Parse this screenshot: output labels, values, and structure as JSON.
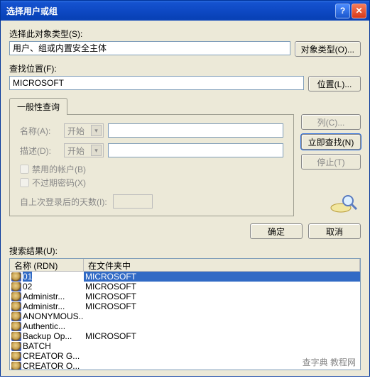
{
  "title": "选择用户或组",
  "labels": {
    "object_type": "选择此对象类型(S):",
    "object_value": "用户、组或内置安全主体",
    "btn_object_types": "对象类型(O)...",
    "location": "查找位置(F):",
    "location_value": "MICROSOFT",
    "btn_locations": "位置(L)...",
    "tab_general": "一般性查询",
    "name": "名称(A):",
    "desc": "描述(D):",
    "starts_with": "开始",
    "chk_disabled": "禁用的帐户(B)",
    "chk_noexpire": "不过期密码(X)",
    "days_since": "自上次登录后的天数(I):",
    "btn_columns": "列(C)...",
    "btn_findnow": "立即查找(N)",
    "btn_stop": "停止(T)",
    "btn_ok": "确定",
    "btn_cancel": "取消",
    "results": "搜索结果(U):",
    "col_name": "名称 (RDN)",
    "col_folder": "在文件夹中"
  },
  "results_rows": [
    {
      "name": "01",
      "folder": "MICROSOFT",
      "selected": true
    },
    {
      "name": "02",
      "folder": "MICROSOFT",
      "selected": false
    },
    {
      "name": "Administr...",
      "folder": "MICROSOFT",
      "selected": false
    },
    {
      "name": "Administr...",
      "folder": "MICROSOFT",
      "selected": false
    },
    {
      "name": "ANONYMOUS...",
      "folder": "",
      "selected": false
    },
    {
      "name": "Authentic...",
      "folder": "",
      "selected": false
    },
    {
      "name": "Backup Op...",
      "folder": "MICROSOFT",
      "selected": false
    },
    {
      "name": "BATCH",
      "folder": "",
      "selected": false
    },
    {
      "name": "CREATOR G...",
      "folder": "",
      "selected": false
    },
    {
      "name": "CREATOR O...",
      "folder": "",
      "selected": false
    }
  ],
  "watermark": "查字典 教程网"
}
